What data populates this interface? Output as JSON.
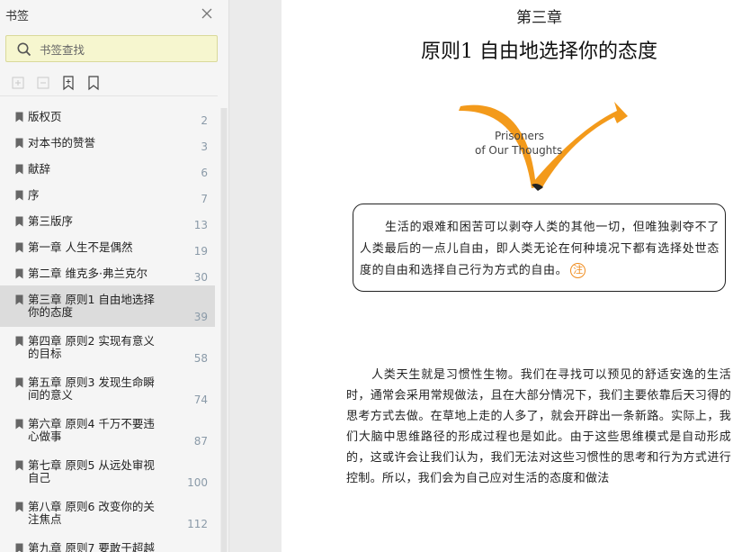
{
  "sidebar": {
    "title": "书签",
    "search_placeholder": "书签查找",
    "items": [
      {
        "label": "版权页",
        "page": "2"
      },
      {
        "label": "对本书的赞誉",
        "page": "3"
      },
      {
        "label": "献辞",
        "page": "6"
      },
      {
        "label": "序",
        "page": "7"
      },
      {
        "label": "第三版序",
        "page": "13"
      },
      {
        "label": "第一章  人生不是偶然",
        "page": "19"
      },
      {
        "label": "第二章  维克多·弗兰克尔",
        "page": "30"
      },
      {
        "label": "第三章  原则1  自由地选择\n你的态度",
        "page": "39",
        "active": true
      },
      {
        "label": "第四章  原则2  实现有意义\n的目标",
        "page": "58"
      },
      {
        "label": "第五章  原则3  发现生命瞬\n间的意义",
        "page": "74"
      },
      {
        "label": "第六章  原则4  千万不要违\n心做事",
        "page": "87"
      },
      {
        "label": "第七章  原则5  从远处审视\n自己",
        "page": "100"
      },
      {
        "label": "第八章  原则6  改变你的关\n注焦点",
        "page": "112"
      },
      {
        "label": "第九章  原则7  要敢于超越",
        "page": ""
      }
    ]
  },
  "document": {
    "chapter_label": "第三章",
    "chapter_title": "原则1  自由地选择你的态度",
    "illustration_text": [
      "Prisoners",
      "of Our Thoughts"
    ],
    "quote": "生活的艰难和困苦可以剥夺人类的其他一切，但唯独剥夺不了人类最后的一点儿自由，即人类无论在何种境况下都有选择处世态度的自由和选择自己行为方式的自由。",
    "note_mark": "注",
    "body": "人类天生就是习惯性生物。我们在寻找可以预见的舒适安逸的生活时，通常会采用常规做法，且在大部分情况下，我们主要依靠后天习得的思考方式去做。在草地上走的人多了，就会开辟出一条新路。实际上，我们大脑中思维路径的形成过程也是如此。由于这些思维模式是自动形成的，这或许会让我们认为，我们无法对这些习惯性的思考和行为方式进行控制。所以，我们会为自己应对生活的态度和做法"
  },
  "colors": {
    "accent_orange": "#f39a1b",
    "search_bg": "#f6f6cf",
    "active_item_bg": "#dcdcdc"
  }
}
